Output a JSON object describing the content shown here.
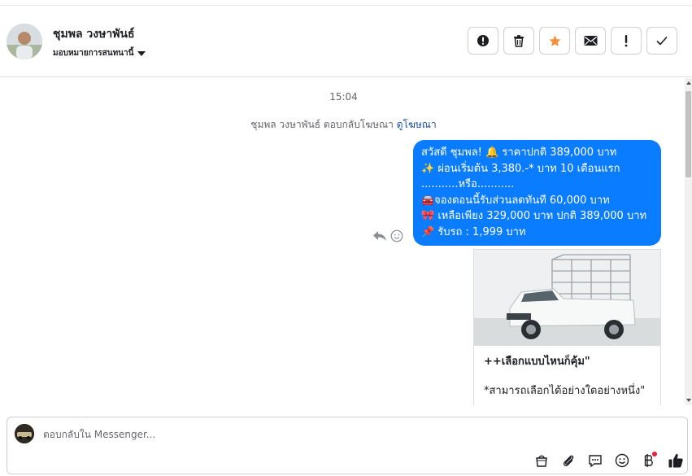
{
  "header": {
    "contact_name": "ชุมพล วงษาพันธ์",
    "assign_label": "มอบหมายการสนทนานี้",
    "actions": [
      {
        "name": "report-spam",
        "icon": "alert-circle-icon"
      },
      {
        "name": "delete",
        "icon": "trash-icon"
      },
      {
        "name": "star",
        "icon": "star-icon",
        "color": "#f5913e"
      },
      {
        "name": "mark-unread",
        "icon": "envelope-icon"
      },
      {
        "name": "follow-up",
        "icon": "exclamation-icon"
      },
      {
        "name": "mark-done",
        "icon": "check-icon"
      }
    ]
  },
  "chat": {
    "timestamp": "15:04",
    "ad_reply_text": "ชุมพล วงษาพันธ์ ตอบกลับโฆษณา",
    "ad_link_label": "ดูโฆษณา",
    "message": {
      "lines": [
        "สวัสดี ชุมพล! 🔔 ราคาปกติ 389,000 บาท",
        "✨  ผ่อนเริ่มต้น 3,380.-* บาท 10 เดือนแรก",
        "...........หรือ...........",
        "🚘จองตอนนี้รับส่วนลดทันที 60,000 บาท",
        "🎀  เหลือเพียง 329,000 บาท ปกติ 389,000 บาท",
        "📌 รับรถ : 1,999 บาท"
      ],
      "bubble_color": "#0a7cff"
    },
    "card": {
      "line1": "++เลือกแบบไหนก็คุ้ม\"",
      "line2": "*สามารถเลือกได้อย่างใดอย่างหนึ่ง\""
    }
  },
  "composer": {
    "placeholder": "ตอบกลับใน Messenger...",
    "tools": [
      "shopping-bag-icon",
      "paperclip-icon",
      "chat-bubble-icon",
      "smiley-icon",
      "baht-icon",
      "thumbs-up-icon"
    ],
    "accent": "#1c1e21"
  }
}
